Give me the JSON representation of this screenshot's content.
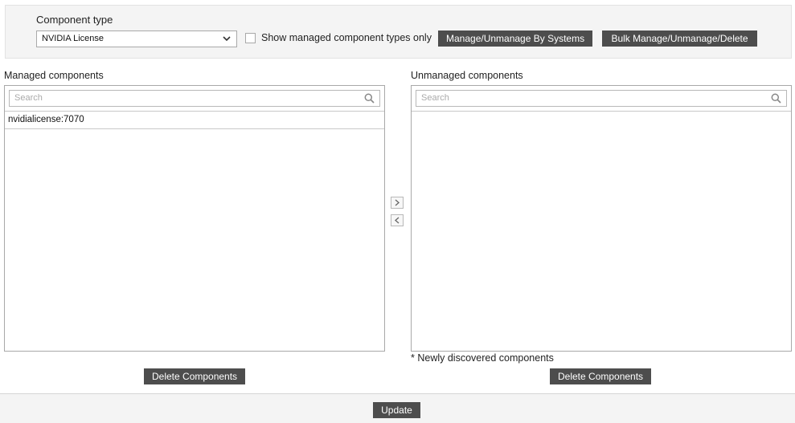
{
  "component_type": {
    "label": "Component type",
    "selected": "NVIDIA License"
  },
  "show_managed_only_label": "Show managed component types only",
  "buttons": {
    "manage_by_systems": "Manage/Unmanage By Systems",
    "bulk": "Bulk Manage/Unmanage/Delete",
    "delete_managed": "Delete Components",
    "delete_unmanaged": "Delete Components",
    "update": "Update"
  },
  "managed": {
    "title": "Managed components",
    "search_placeholder": "Search",
    "items": [
      "nvidialicense:7070"
    ]
  },
  "unmanaged": {
    "title": "Unmanaged components",
    "search_placeholder": "Search",
    "items": []
  },
  "note": "* Newly discovered components",
  "icons": {
    "search": "search-icon",
    "dropdown": "chevron-down-icon",
    "move_right": "chevron-right-icon",
    "move_left": "chevron-left-icon"
  }
}
